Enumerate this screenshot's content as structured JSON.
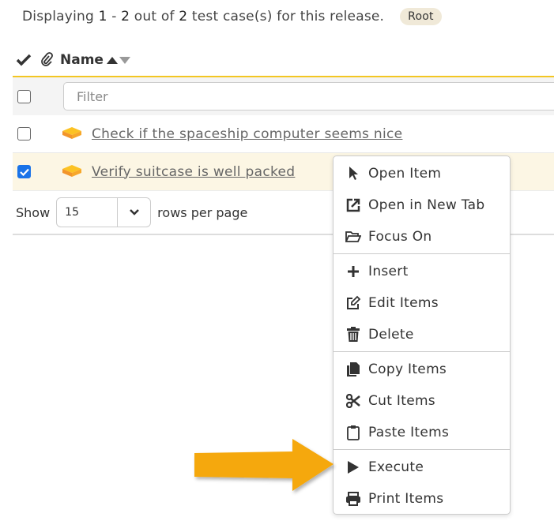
{
  "summary": {
    "prefix": "Displaying",
    "from": "1",
    "dash": "-",
    "to": "2",
    "middle": "out of",
    "total": "2",
    "suffix": "test case(s) for this release.",
    "badge": "Root"
  },
  "header": {
    "check_icon": "check-icon",
    "attach_icon": "paperclip-icon",
    "name_label": "Name",
    "sort": "ascending"
  },
  "filter": {
    "placeholder": "Filter",
    "value": ""
  },
  "rows": [
    {
      "label": "Check if the spaceship computer seems nice",
      "checked": false,
      "icon": "test-case-icon"
    },
    {
      "label": "Verify suitcase is well packed",
      "checked": true,
      "icon": "test-case-icon"
    }
  ],
  "pager": {
    "show_label": "Show",
    "page_size": "15",
    "suffix": "rows per page"
  },
  "context_menu": {
    "groups": [
      [
        {
          "label": "Open Item",
          "icon": "pointer-icon"
        },
        {
          "label": "Open in New Tab",
          "icon": "external-link-icon"
        },
        {
          "label": "Focus On",
          "icon": "folder-open-icon"
        }
      ],
      [
        {
          "label": "Insert",
          "icon": "plus-icon"
        },
        {
          "label": "Edit Items",
          "icon": "edit-icon"
        },
        {
          "label": "Delete",
          "icon": "trash-icon"
        }
      ],
      [
        {
          "label": "Copy Items",
          "icon": "copy-icon"
        },
        {
          "label": "Cut Items",
          "icon": "scissors-icon"
        },
        {
          "label": "Paste Items",
          "icon": "clipboard-icon"
        }
      ],
      [
        {
          "label": "Execute",
          "icon": "play-icon"
        },
        {
          "label": "Print Items",
          "icon": "print-icon"
        }
      ]
    ]
  },
  "colors": {
    "accent_border": "#f3c623",
    "selected_row": "#fcf6e4",
    "checkbox_checked": "#1a73e8",
    "annotation_arrow": "#f5a80b"
  }
}
